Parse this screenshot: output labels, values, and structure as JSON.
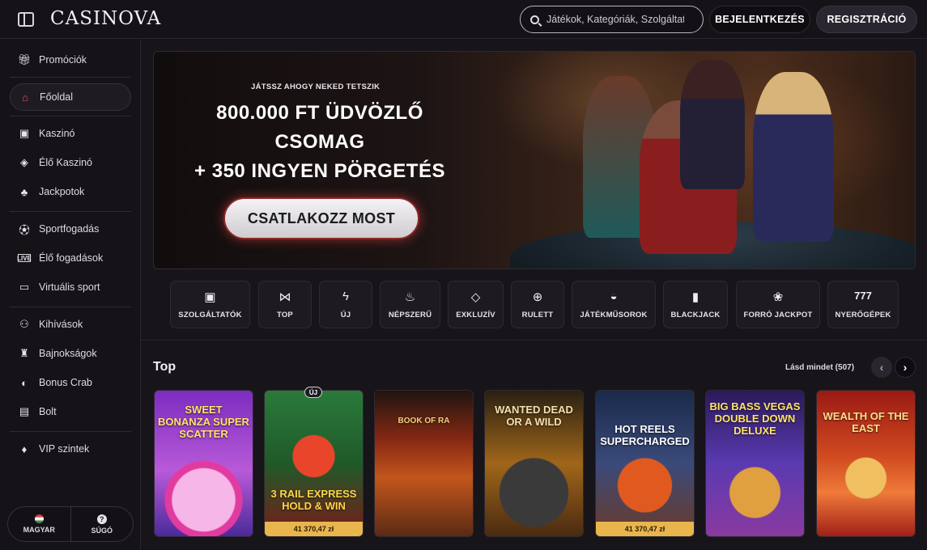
{
  "header": {
    "logo": "CASINOVA",
    "search_placeholder": "Játékok, Kategóriák, Szolgáltatók",
    "login_label": "BEJELENTKEZÉS",
    "register_label": "REGISZTRÁCIÓ"
  },
  "sidebar": {
    "items": [
      {
        "label": "Promóciók",
        "icon": "gift-icon"
      },
      {
        "label": "Főoldal",
        "icon": "home-icon",
        "active": true
      },
      {
        "label": "Kaszinó",
        "icon": "slot-machine-icon"
      },
      {
        "label": "Élő Kaszinó",
        "icon": "live-casino-icon"
      },
      {
        "label": "Jackpotok",
        "icon": "clover-icon"
      },
      {
        "label": "Sportfogadás",
        "icon": "football-icon"
      },
      {
        "label": "Élő fogadások",
        "icon": "live-badge-icon"
      },
      {
        "label": "Virtuális sport",
        "icon": "virtual-sport-icon"
      },
      {
        "label": "Kihívások",
        "icon": "medal-icon"
      },
      {
        "label": "Bajnokságok",
        "icon": "trophy-icon"
      },
      {
        "label": "Bonus Crab",
        "icon": "crab-icon"
      },
      {
        "label": "Bolt",
        "icon": "shop-icon"
      },
      {
        "label": "VIP szintek",
        "icon": "diamond-icon"
      }
    ],
    "footer": {
      "language_label": "MAGYAR",
      "help_label": "SÚGÓ"
    }
  },
  "banner": {
    "eyebrow": "JÁTSSZ AHOGY NEKED TETSZIK",
    "title_line1": "800.000 FT ÜDVÖZLŐ",
    "title_line2": "CSOMAG",
    "title_line3": "+ 350 INGYEN PÖRGETÉS",
    "cta_label": "CSATLAKOZZ MOST"
  },
  "categories": [
    {
      "label": "SZOLGÁLTATÓK",
      "icon": "providers-icon"
    },
    {
      "label": "TOP",
      "icon": "bowtie-icon"
    },
    {
      "label": "ÚJ",
      "icon": "lightning-icon"
    },
    {
      "label": "NÉPSZERŰ",
      "icon": "flame-icon"
    },
    {
      "label": "EXKLUZÍV",
      "icon": "diamond-icon"
    },
    {
      "label": "RULETT",
      "icon": "roulette-icon"
    },
    {
      "label": "JÁTÉKMŰSOROK",
      "icon": "mask-icon"
    },
    {
      "label": "BLACKJACK",
      "icon": "cards-icon"
    },
    {
      "label": "FORRÓ JACKPOT",
      "icon": "hot-jackpot-icon"
    },
    {
      "label": "NYERŐGÉPEK",
      "icon": "777-icon"
    }
  ],
  "top_section": {
    "title": "Top",
    "see_all": "Lásd mindet (507)",
    "new_badge": "ÚJ",
    "games": [
      {
        "name": "SWEET BONANZA SUPER SCATTER",
        "jackpot": ""
      },
      {
        "name": "3 RAIL EXPRESS HOLD & WIN",
        "jackpot": "41 370,47 zł"
      },
      {
        "name": "BOOK OF RA",
        "jackpot": ""
      },
      {
        "name": "WANTED DEAD OR A WILD",
        "jackpot": ""
      },
      {
        "name": "HOT REELS SUPERCHARGED",
        "jackpot": "41 370,47 zł"
      },
      {
        "name": "BIG BASS VEGAS DOUBLE DOWN DELUXE",
        "jackpot": ""
      },
      {
        "name": "WEALTH OF THE EAST",
        "jackpot": ""
      }
    ]
  }
}
